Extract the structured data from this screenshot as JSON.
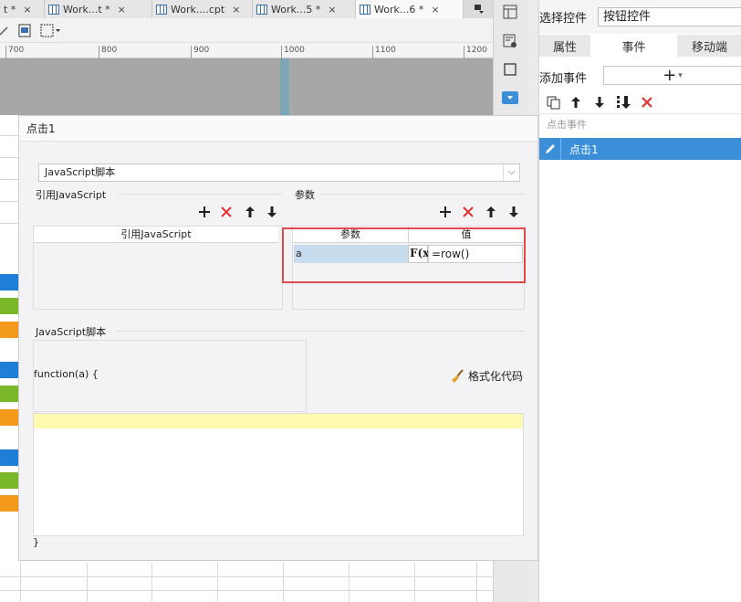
{
  "tabs": [
    {
      "label": "t *",
      "active": false
    },
    {
      "label": "Work...t *",
      "active": false
    },
    {
      "label": "Work....cpt",
      "active": false
    },
    {
      "label": "Work...5 *",
      "active": false
    },
    {
      "label": "Work...6 *",
      "active": true
    }
  ],
  "tab_close_glyph": "×",
  "ruler": {
    "ticks": [
      "700",
      "800",
      "900",
      "1000",
      "1100",
      "1200"
    ]
  },
  "right_panel": {
    "select_label": "选择控件",
    "select_value": "按钮控件",
    "tabs": [
      "属性",
      "事件",
      "移动端"
    ],
    "active_tab": "事件",
    "add_event_label": "添加事件",
    "add_event_icon": "+",
    "event_list_header": "点击事件",
    "events": [
      "点击1"
    ]
  },
  "dialog": {
    "title": "点击1",
    "type_select": "JavaScript脚本",
    "ref_js_section": "引用JavaScript",
    "ref_js_column": "引用JavaScript",
    "params_section": "参数",
    "params_columns": [
      "参数",
      "值"
    ],
    "params_rows": [
      {
        "name": "a",
        "value": "=row()"
      }
    ],
    "fx_label": "F(x)",
    "js_section": "JavaScript脚本",
    "function_sig": "function(a) {",
    "format_code_label": "格式化代码",
    "closing_brace": "}"
  },
  "colors": {
    "accent_blue": "#3b8fd9",
    "highlight_red": "#e14a4a",
    "code_line_yellow": "#fffab0",
    "delete_red": "#e23232"
  }
}
